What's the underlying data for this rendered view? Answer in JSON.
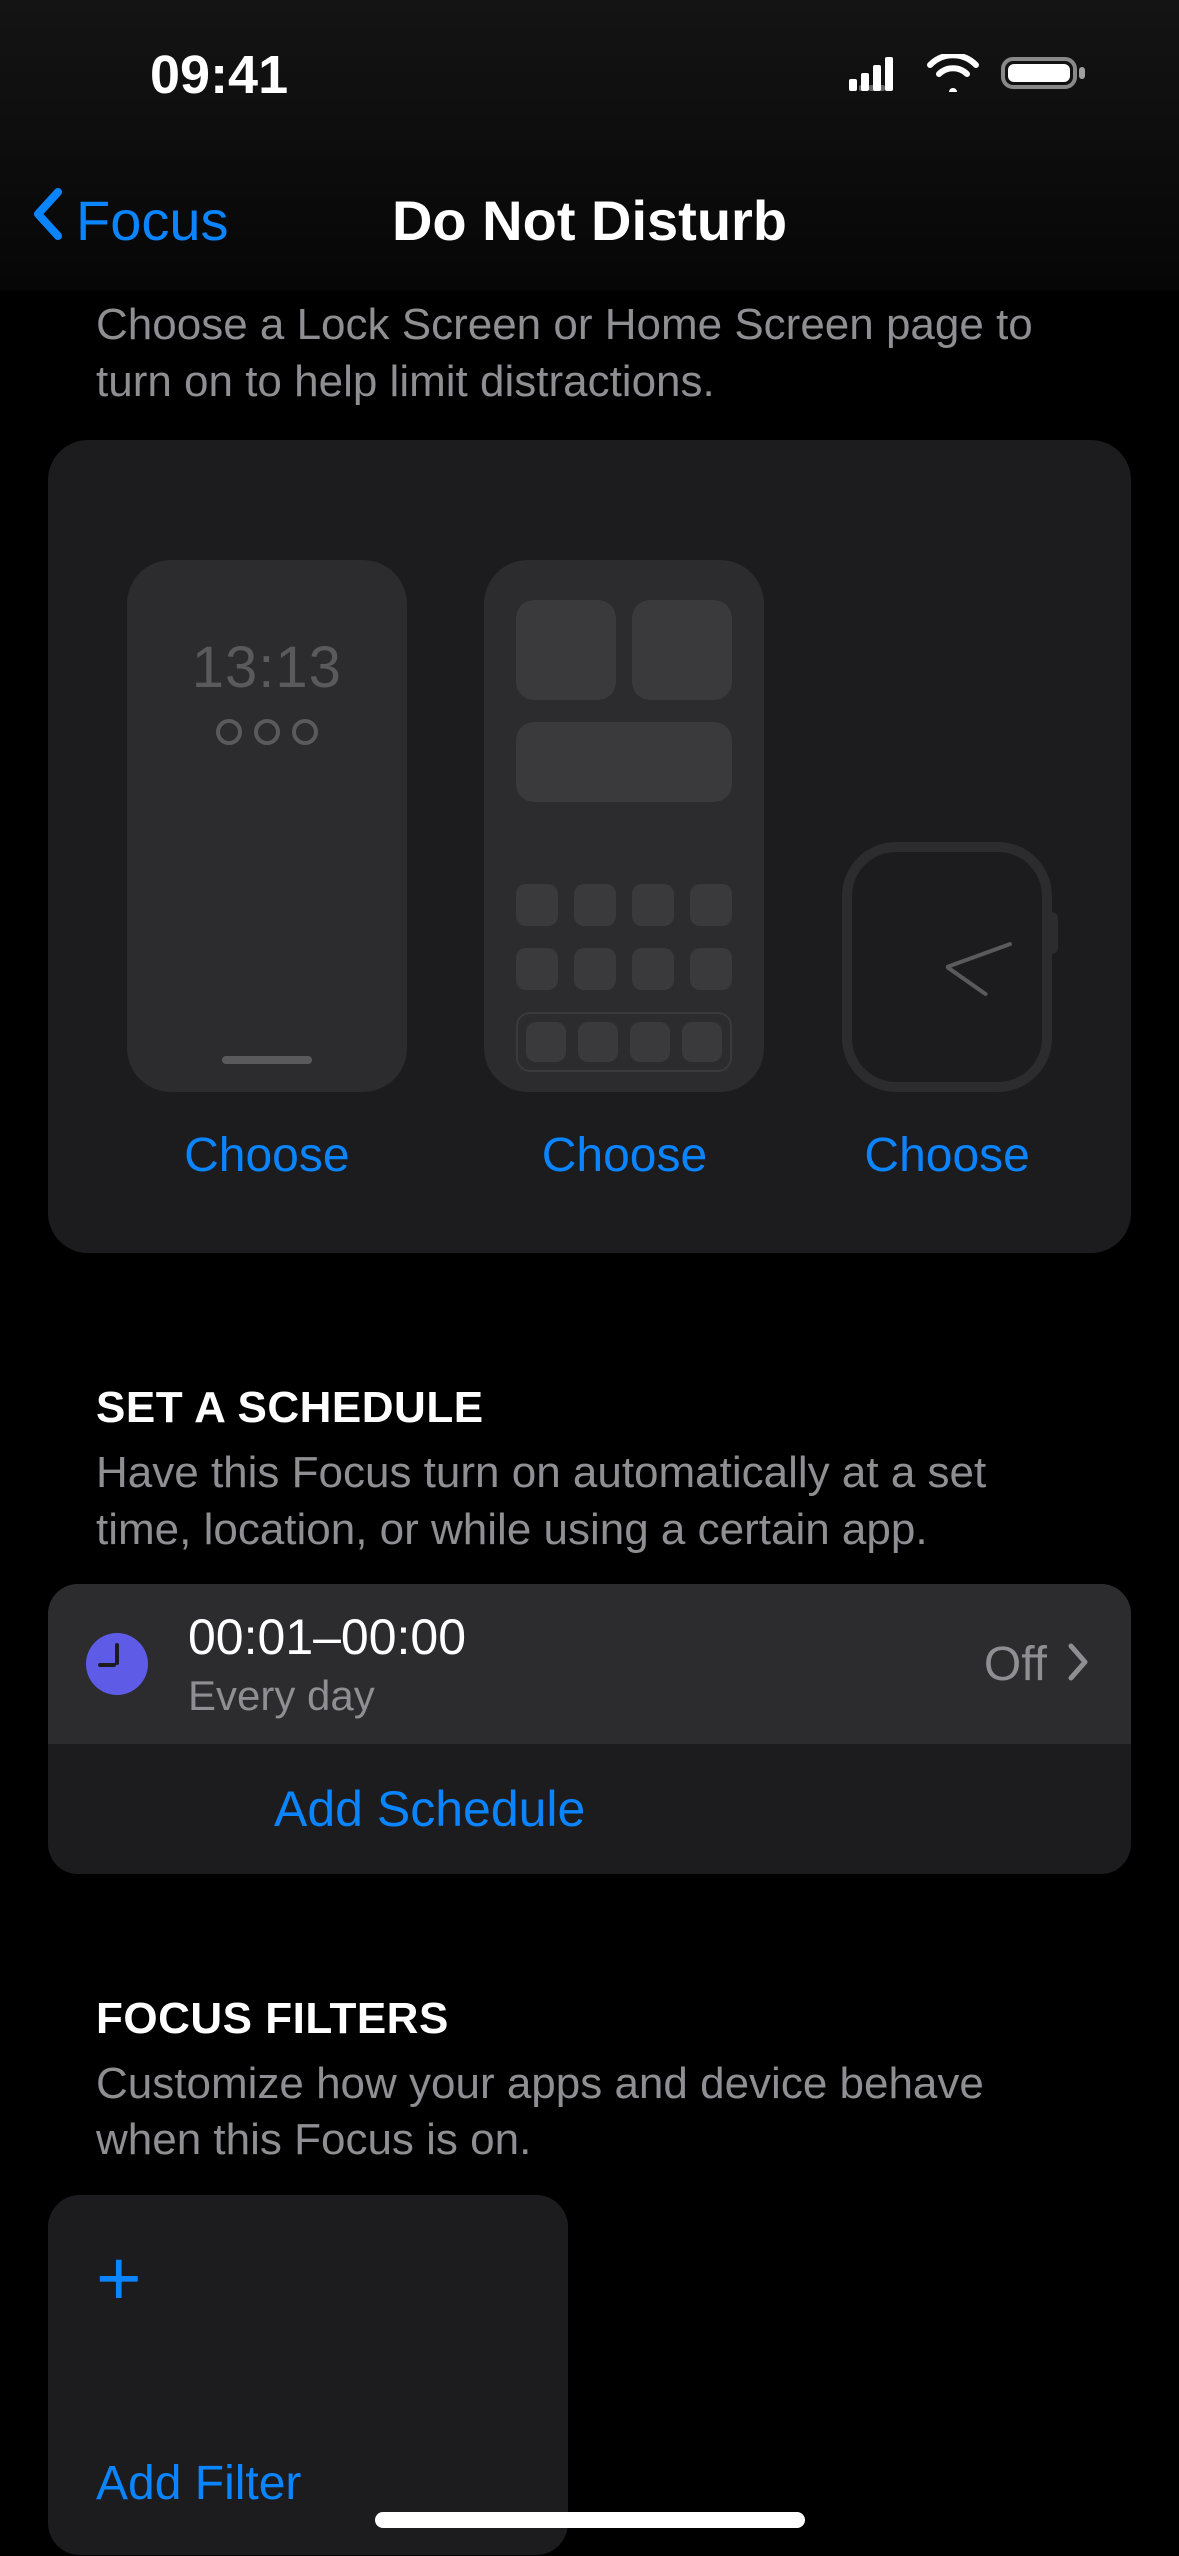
{
  "status": {
    "time": "09:41",
    "signal_icon": "cellular-signal-icon",
    "wifi_icon": "wifi-icon",
    "battery_icon": "battery-icon"
  },
  "nav": {
    "back_label": "Focus",
    "title": "Do Not Disturb"
  },
  "customize": {
    "intro": "Choose a Lock Screen or Home Screen page to turn on to help limit distractions.",
    "lock_preview_time": "13:13",
    "choose_label": "Choose"
  },
  "schedule": {
    "header": "SET A SCHEDULE",
    "sub": "Have this Focus turn on automatically at a set time, location, or while using a certain app.",
    "item": {
      "time_range": "00:01–00:00",
      "repeat": "Every day",
      "status": "Off"
    },
    "add_label": "Add Schedule"
  },
  "filters": {
    "header": "FOCUS FILTERS",
    "sub": "Customize how your apps and device behave when this Focus is on.",
    "add_label": "Add Filter"
  }
}
